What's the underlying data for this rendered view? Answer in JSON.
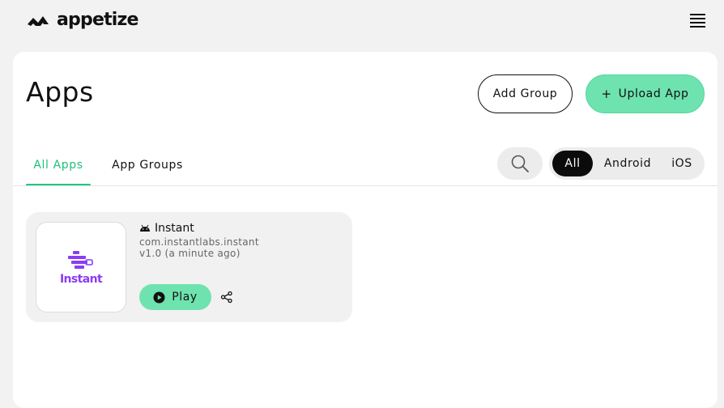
{
  "brand": {
    "name": "appetize"
  },
  "header": {
    "title": "Apps"
  },
  "actions": {
    "add_group": "Add Group",
    "upload_app": "Upload App"
  },
  "tabs": [
    {
      "label": "All Apps",
      "active": true
    },
    {
      "label": "App Groups",
      "active": false
    }
  ],
  "filters": {
    "options": [
      "All",
      "Android",
      "iOS"
    ],
    "selected": "All"
  },
  "apps": [
    {
      "name": "Instant",
      "platform_icon": "android-icon",
      "bundle_id": "com.instantlabs.instant",
      "version": "v1.0 (a minute ago)",
      "icon_text": "Instant",
      "play_label": "Play"
    }
  ],
  "icons": {
    "menu": "hamburger-menu-icon",
    "search": "search-icon",
    "share": "share-icon",
    "play": "play-circle-icon",
    "upload": "plus-icon"
  },
  "colors": {
    "accent": "#6ee3af",
    "accent_text": "#1fbf7a",
    "brand_purple": "#8b3cf5",
    "dark": "#0b0b0b"
  }
}
